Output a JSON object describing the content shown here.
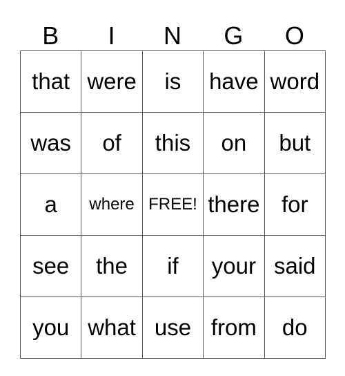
{
  "header": [
    "B",
    "I",
    "N",
    "G",
    "O"
  ],
  "rows": [
    [
      "that",
      "were",
      "is",
      "have",
      "word"
    ],
    [
      "was",
      "of",
      "this",
      "on",
      "but"
    ],
    [
      "a",
      "where",
      "FREE!",
      "there",
      "for"
    ],
    [
      "see",
      "the",
      "if",
      "your",
      "said"
    ],
    [
      "you",
      "what",
      "use",
      "from",
      "do"
    ]
  ]
}
